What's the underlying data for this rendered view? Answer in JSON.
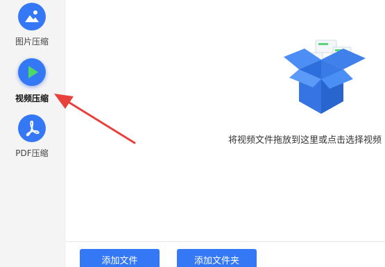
{
  "sidebar": {
    "items": [
      {
        "label": "图片压缩",
        "icon": "image-icon"
      },
      {
        "label": "视频压缩",
        "icon": "play-icon"
      },
      {
        "label": "PDF压缩",
        "icon": "pdf-icon"
      }
    ]
  },
  "main": {
    "drop_hint": "将视频文件拖放到这里或点击选择视频"
  },
  "footer": {
    "add_file_label": "添加文件",
    "add_folder_label": "添加文件夹"
  },
  "colors": {
    "accent": "#3478f6",
    "annotation_arrow": "#e8403a"
  }
}
